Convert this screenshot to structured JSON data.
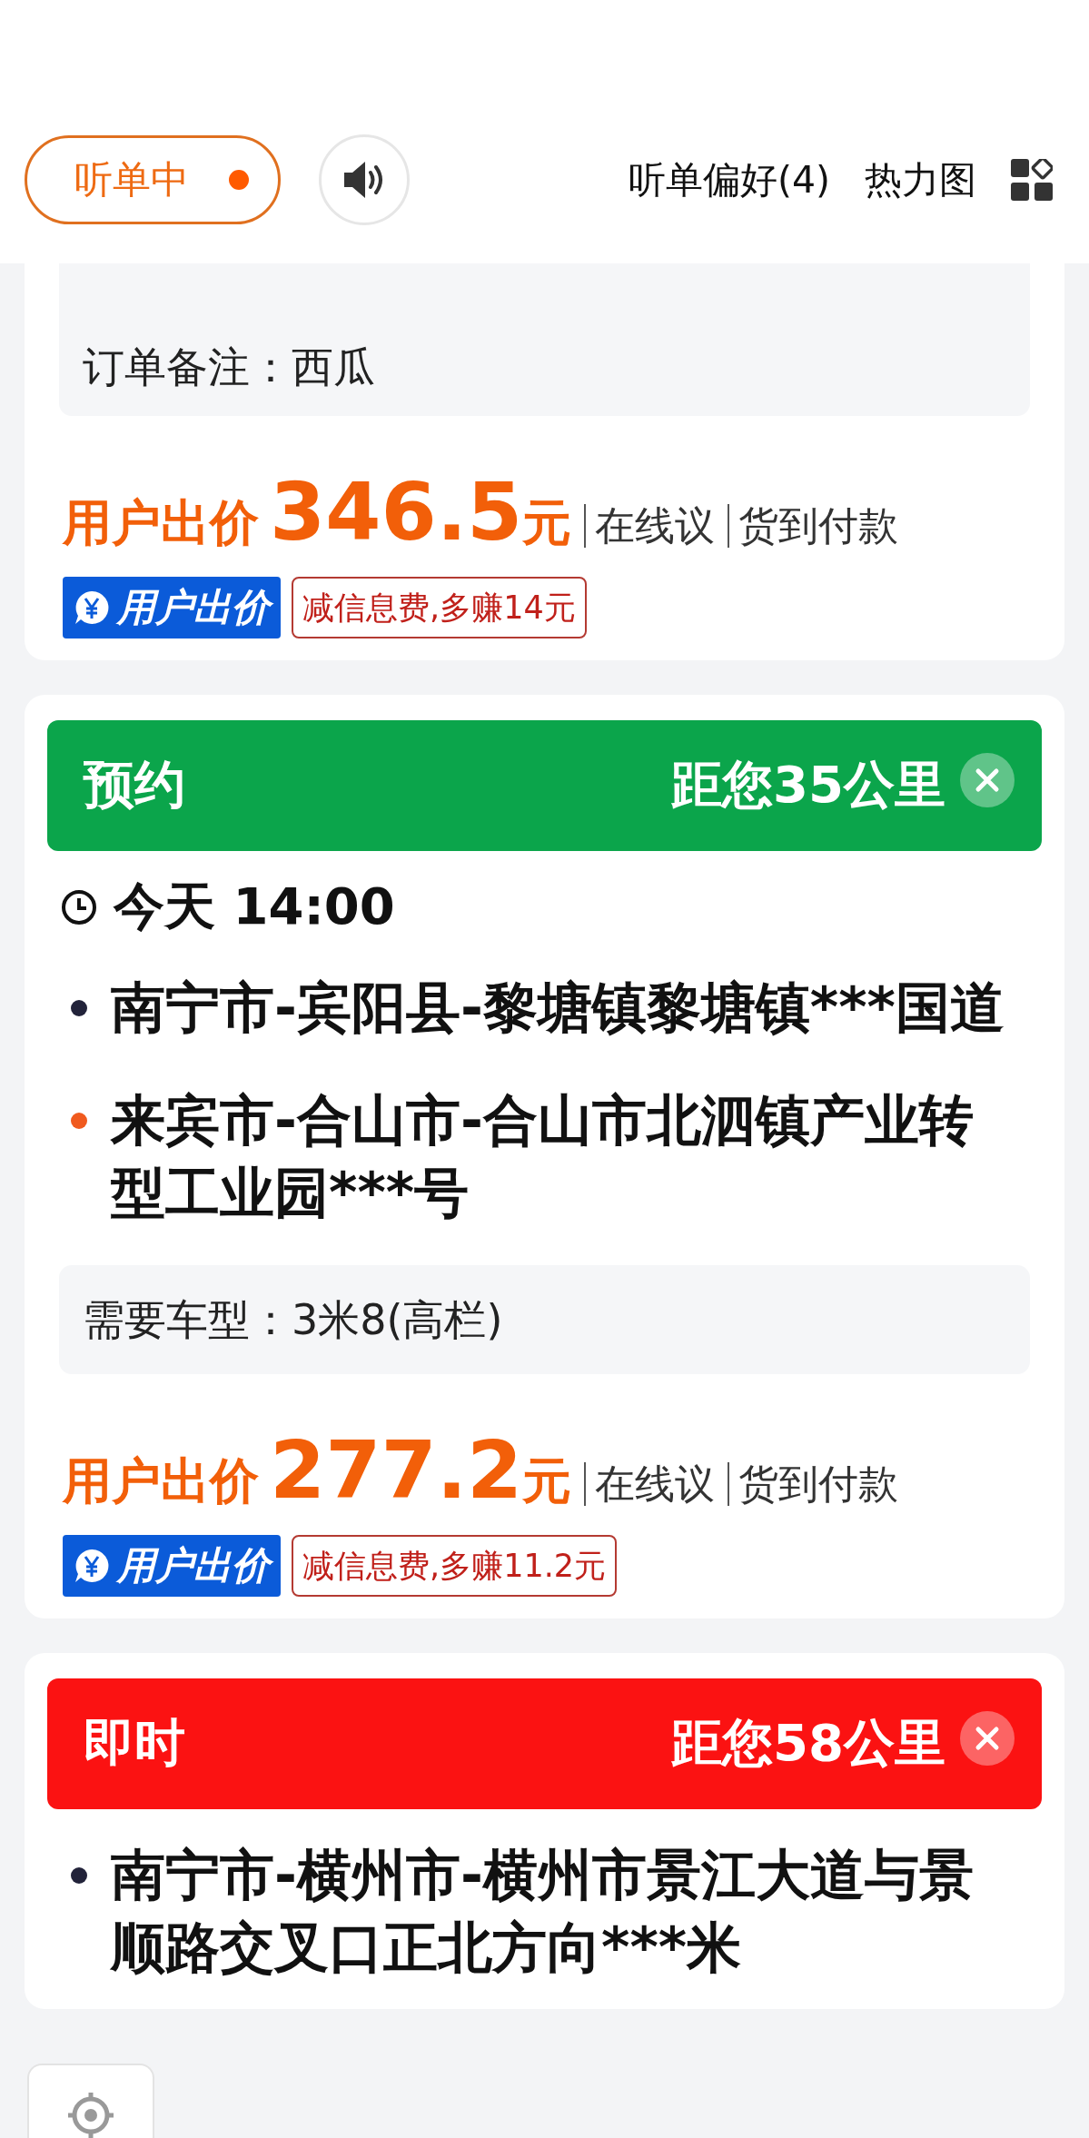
{
  "header": {
    "status": {
      "label": "听单中",
      "on": true
    },
    "sound_on": true,
    "links": [
      "听单偏好(4)",
      "热力图"
    ]
  },
  "orders": [
    {
      "details": [
        {
          "label": "订单备注：",
          "value": "西瓜"
        }
      ],
      "price": {
        "label": "用户出价",
        "amount": "346.5",
        "unit": "元",
        "options": [
          "在线议",
          "货到付款"
        ]
      },
      "badges": {
        "offer": "用户出价",
        "bonus": "减信息费,多赚14元"
      }
    },
    {
      "tag": {
        "label": "预约",
        "color": "#0ba54b"
      },
      "distance": "距您35公里",
      "time": "今天 14:00",
      "stops": [
        {
          "kind": "pickup",
          "address": "南宁市-宾阳县-黎塘镇黎塘镇***国道"
        },
        {
          "kind": "dropoff",
          "address": "来宾市-合山市-合山市北泗镇产业转型工业园***号"
        }
      ],
      "details": [
        {
          "label": "需要车型：",
          "value": "3米8(高栏)"
        }
      ],
      "price": {
        "label": "用户出价",
        "amount": "277.2",
        "unit": "元",
        "options": [
          "在线议",
          "货到付款"
        ]
      },
      "badges": {
        "offer": "用户出价",
        "bonus": "减信息费,多赚11.2元"
      }
    },
    {
      "tag": {
        "label": "即时",
        "color": "#fb1212"
      },
      "distance": "距您58公里",
      "stops": [
        {
          "kind": "pickup",
          "address": "南宁市-横州市-横州市景江大道与景顺路交叉口正北方向***米"
        }
      ]
    }
  ]
}
